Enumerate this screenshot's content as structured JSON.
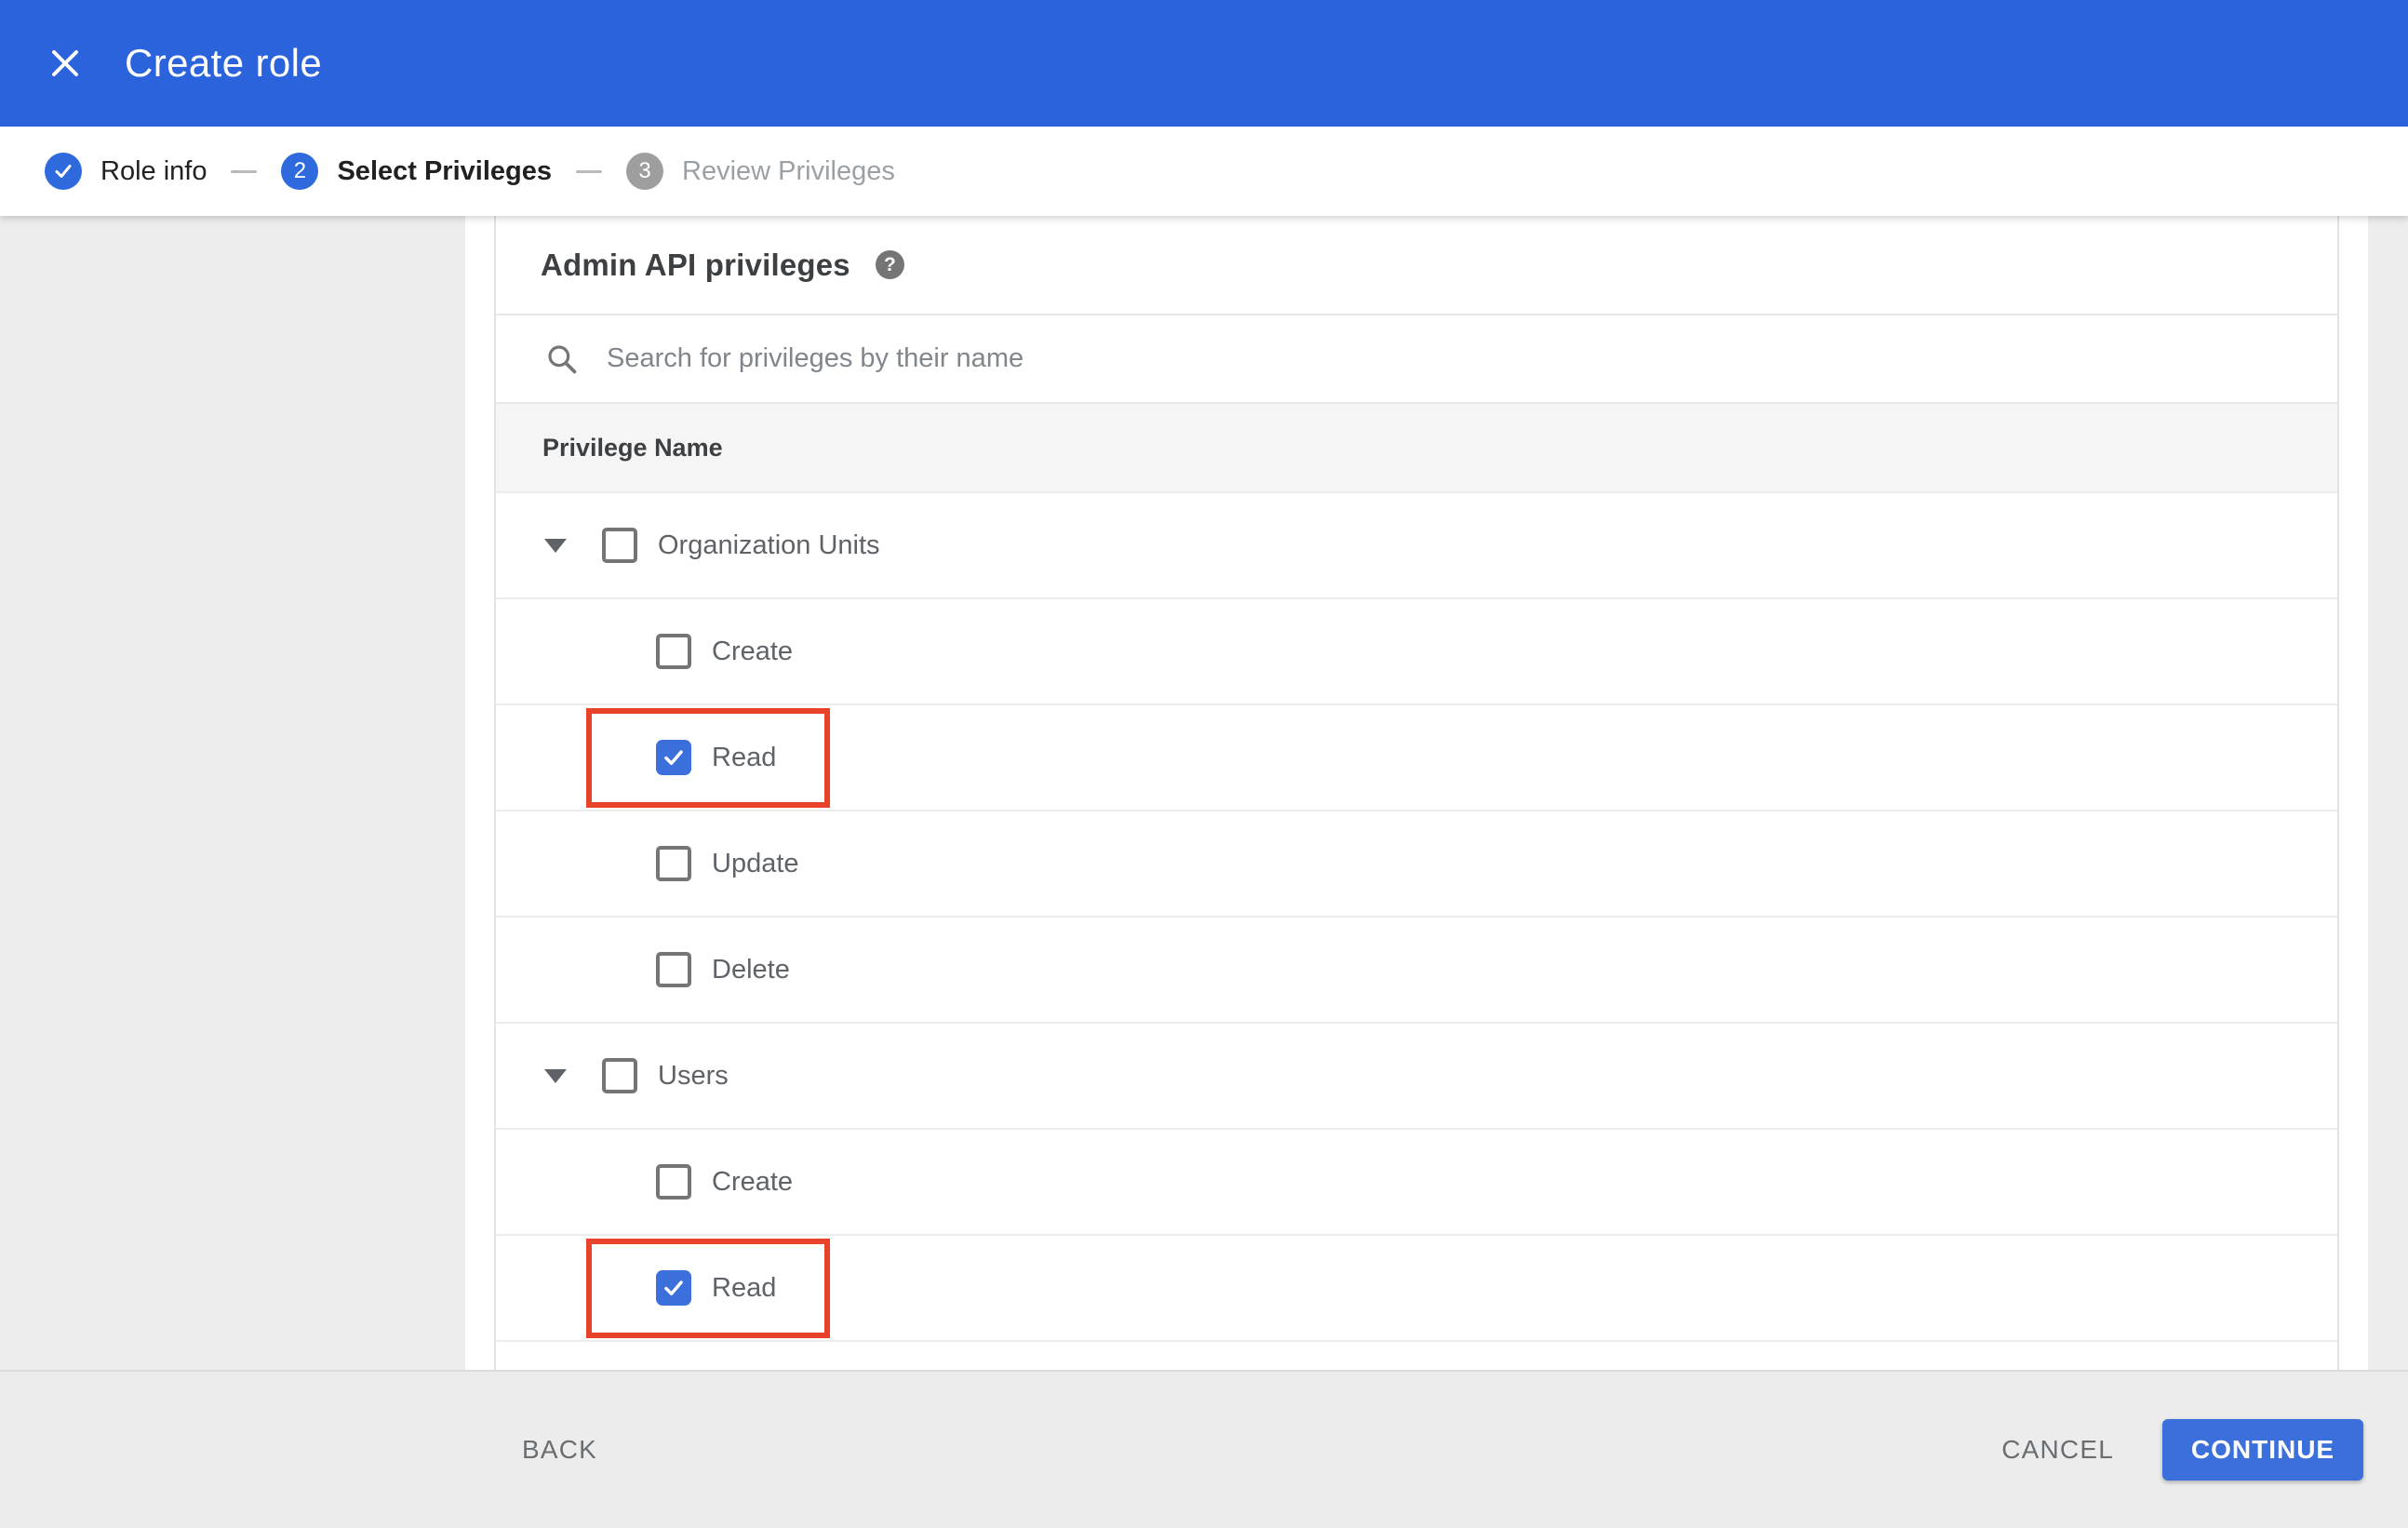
{
  "header": {
    "title": "Create role"
  },
  "stepper": {
    "steps": [
      {
        "label": "Role info",
        "state": "complete"
      },
      {
        "number": "2",
        "label": "Select Privileges",
        "state": "active"
      },
      {
        "number": "3",
        "label": "Review Privileges",
        "state": "upcoming"
      }
    ]
  },
  "content": {
    "section_title": "Admin API privileges",
    "search_placeholder": "Search for privileges by their name",
    "table": {
      "header": "Privilege Name",
      "groups": [
        {
          "label": "Organization Units",
          "checked": false,
          "expanded": true,
          "children": [
            {
              "label": "Create",
              "checked": false,
              "highlighted": false
            },
            {
              "label": "Read",
              "checked": true,
              "highlighted": true
            },
            {
              "label": "Update",
              "checked": false,
              "highlighted": false
            },
            {
              "label": "Delete",
              "checked": false,
              "highlighted": false
            }
          ]
        },
        {
          "label": "Users",
          "checked": false,
          "expanded": true,
          "children": [
            {
              "label": "Create",
              "checked": false,
              "highlighted": false
            },
            {
              "label": "Read",
              "checked": true,
              "highlighted": true
            }
          ]
        }
      ]
    }
  },
  "footer": {
    "back_label": "BACK",
    "cancel_label": "CANCEL",
    "continue_label": "CONTINUE"
  },
  "icons": {
    "close": "x-icon",
    "step_complete": "check-icon",
    "help": "question-mark-icon",
    "search": "magnifier-icon",
    "expander": "triangle-down-icon",
    "checked_checkbox": "check-icon"
  },
  "colors": {
    "appbar_blue": "#2B63DC",
    "accent_blue": "#3B6FDB",
    "step_inactive_gray": "#9E9E9E",
    "highlight_red": "#E8432A",
    "page_background": "#EDEDED",
    "table_header_bg": "#F5F5F5",
    "label_gray": "#5F6368"
  }
}
